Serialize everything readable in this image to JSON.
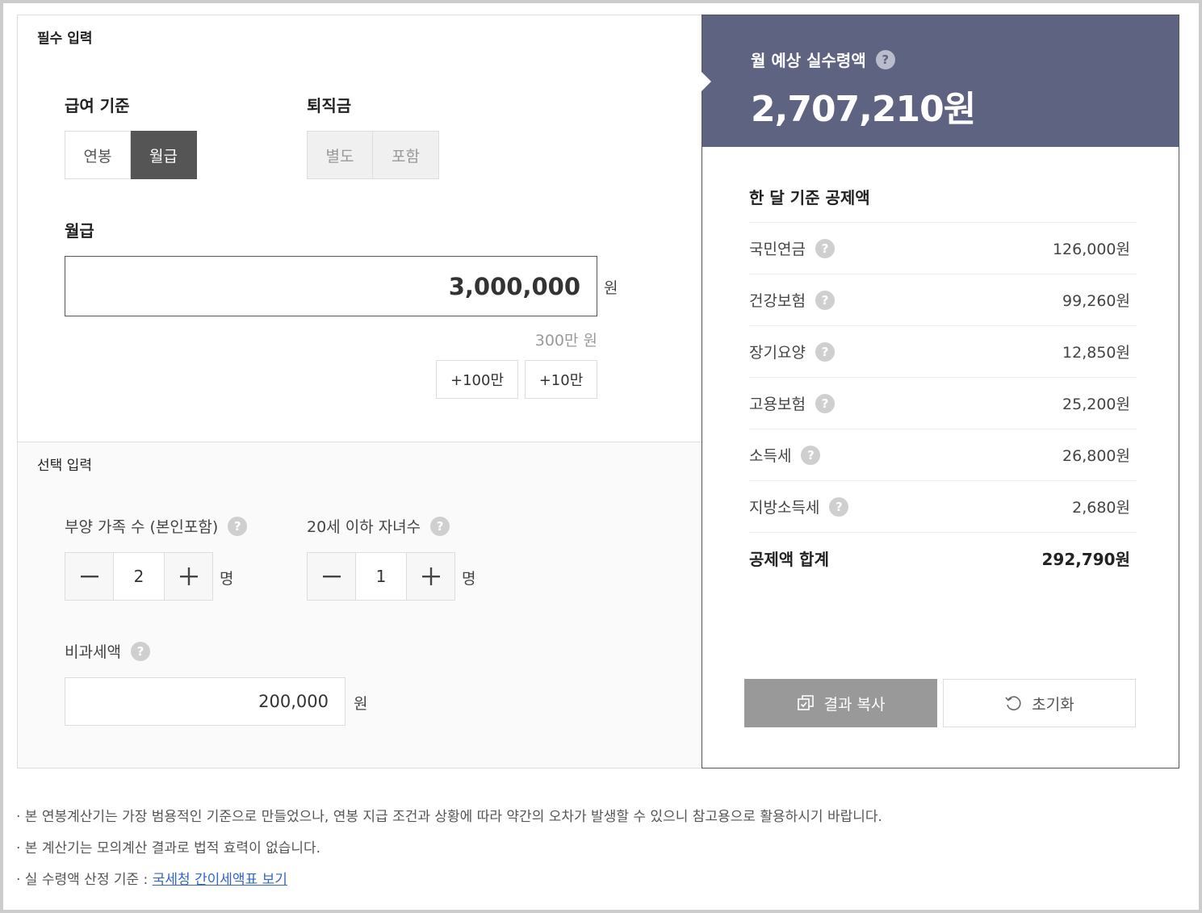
{
  "required": {
    "section_title": "필수 입력",
    "pay_basis": {
      "label": "급여 기준",
      "options": [
        "연봉",
        "월급"
      ],
      "selected": "월급"
    },
    "severance": {
      "label": "퇴직금",
      "options": [
        "별도",
        "포함"
      ]
    },
    "salary": {
      "label": "월급",
      "value": "3,000,000",
      "unit": "원",
      "helper": "300만 원",
      "quick_buttons": [
        "+100만",
        "+10만"
      ]
    }
  },
  "optional": {
    "section_title": "선택 입력",
    "dependents": {
      "label": "부양 가족 수 (본인포함)",
      "value": "2",
      "unit": "명"
    },
    "children": {
      "label": "20세 이하 자녀수",
      "value": "1",
      "unit": "명"
    },
    "nontaxable": {
      "label": "비과세액",
      "value": "200,000",
      "unit": "원"
    }
  },
  "result": {
    "label": "월 예상 실수령액",
    "amount": "2,707,210원",
    "deduction_title": "한 달 기준 공제액",
    "deductions": [
      {
        "name": "국민연금",
        "value": "126,000원"
      },
      {
        "name": "건강보험",
        "value": "99,260원"
      },
      {
        "name": "장기요양",
        "value": "12,850원"
      },
      {
        "name": "고용보험",
        "value": "25,200원"
      },
      {
        "name": "소득세",
        "value": "26,800원"
      },
      {
        "name": "지방소득세",
        "value": "2,680원"
      }
    ],
    "total": {
      "name": "공제액 합계",
      "value": "292,790원"
    },
    "copy_label": "결과 복사",
    "reset_label": "초기화"
  },
  "help_glyph": "?",
  "notes": {
    "line1": "· 본 연봉계산기는 가장 범용적인 기준으로 만들었으나, 연봉 지급 조건과 상황에 따라 약간의 오차가 발생할 수 있으니 참고용으로 활용하시기 바랍니다.",
    "line2": "· 본 계산기는 모의계산 결과로 법적 효력이 없습니다.",
    "line3_prefix": "· 실 수령액 산정 기준 : ",
    "line3_link": "국세청 간이세액표 보기"
  },
  "colors": {
    "result_bg": "#5f6382",
    "active_toggle": "#555555",
    "copy_button": "#999999",
    "link": "#3366cc"
  }
}
